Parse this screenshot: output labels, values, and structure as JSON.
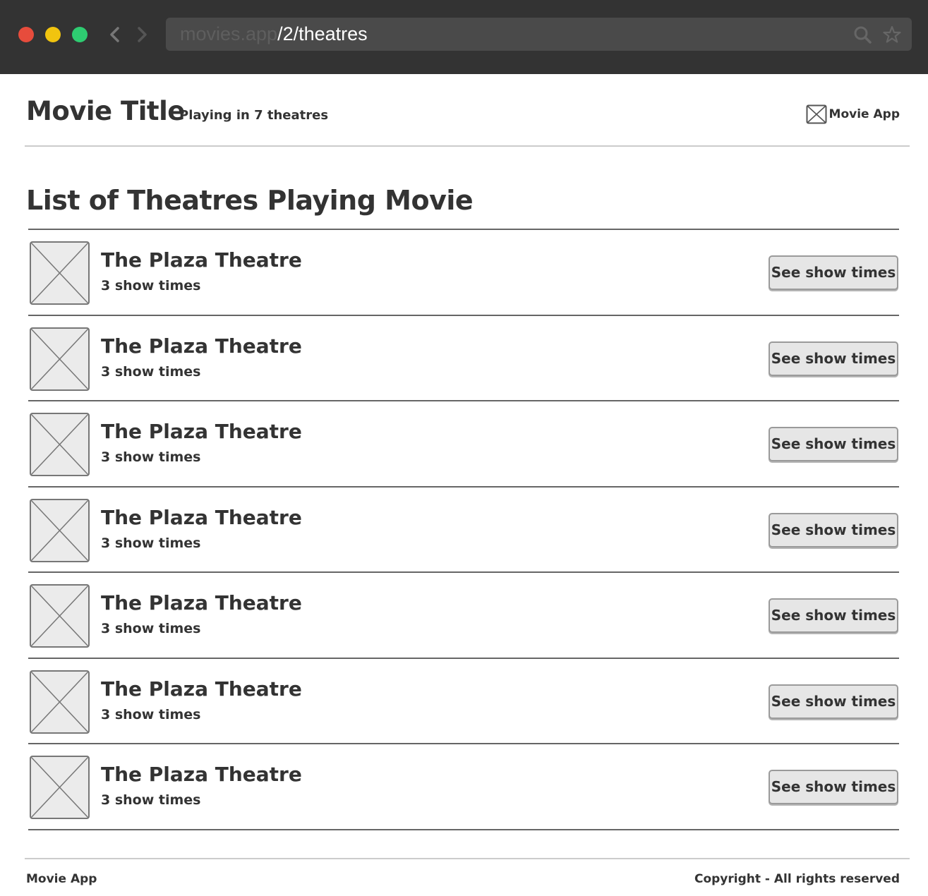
{
  "browser": {
    "url_host": "movies.app",
    "url_path": "/2/theatres"
  },
  "header": {
    "title": "Movie Title",
    "subtitle": "Playing in 7 theatres",
    "brand": "Movie App"
  },
  "main": {
    "heading": "List of Theatres Playing Movie",
    "theatres": [
      {
        "name": "The Plaza Theatre",
        "showtimes": "3 show times",
        "button": "See show times"
      },
      {
        "name": "The Plaza Theatre",
        "showtimes": "3 show times",
        "button": "See show times"
      },
      {
        "name": "The Plaza Theatre",
        "showtimes": "3 show times",
        "button": "See show times"
      },
      {
        "name": "The Plaza Theatre",
        "showtimes": "3 show times",
        "button": "See show times"
      },
      {
        "name": "The Plaza Theatre",
        "showtimes": "3 show times",
        "button": "See show times"
      },
      {
        "name": "The Plaza Theatre",
        "showtimes": "3 show times",
        "button": "See show times"
      },
      {
        "name": "The Plaza Theatre",
        "showtimes": "3 show times",
        "button": "See show times"
      }
    ]
  },
  "footer": {
    "brand": "Movie App",
    "copyright": "Copyright - All rights reserved"
  },
  "icons": {
    "back": "chevron-left-icon",
    "forward": "chevron-right-icon",
    "search": "search-icon",
    "bookmark": "star-icon",
    "logo": "image-placeholder-icon",
    "thumbnail": "image-placeholder-icon"
  },
  "colors": {
    "chrome": "#333333",
    "address_bar": "#4a4a4a",
    "close": "#e74c3c",
    "minimize": "#f1c40f",
    "maximize": "#2ecc71",
    "button_bg": "#e6e6e6",
    "placeholder_bg": "#ebebeb"
  }
}
